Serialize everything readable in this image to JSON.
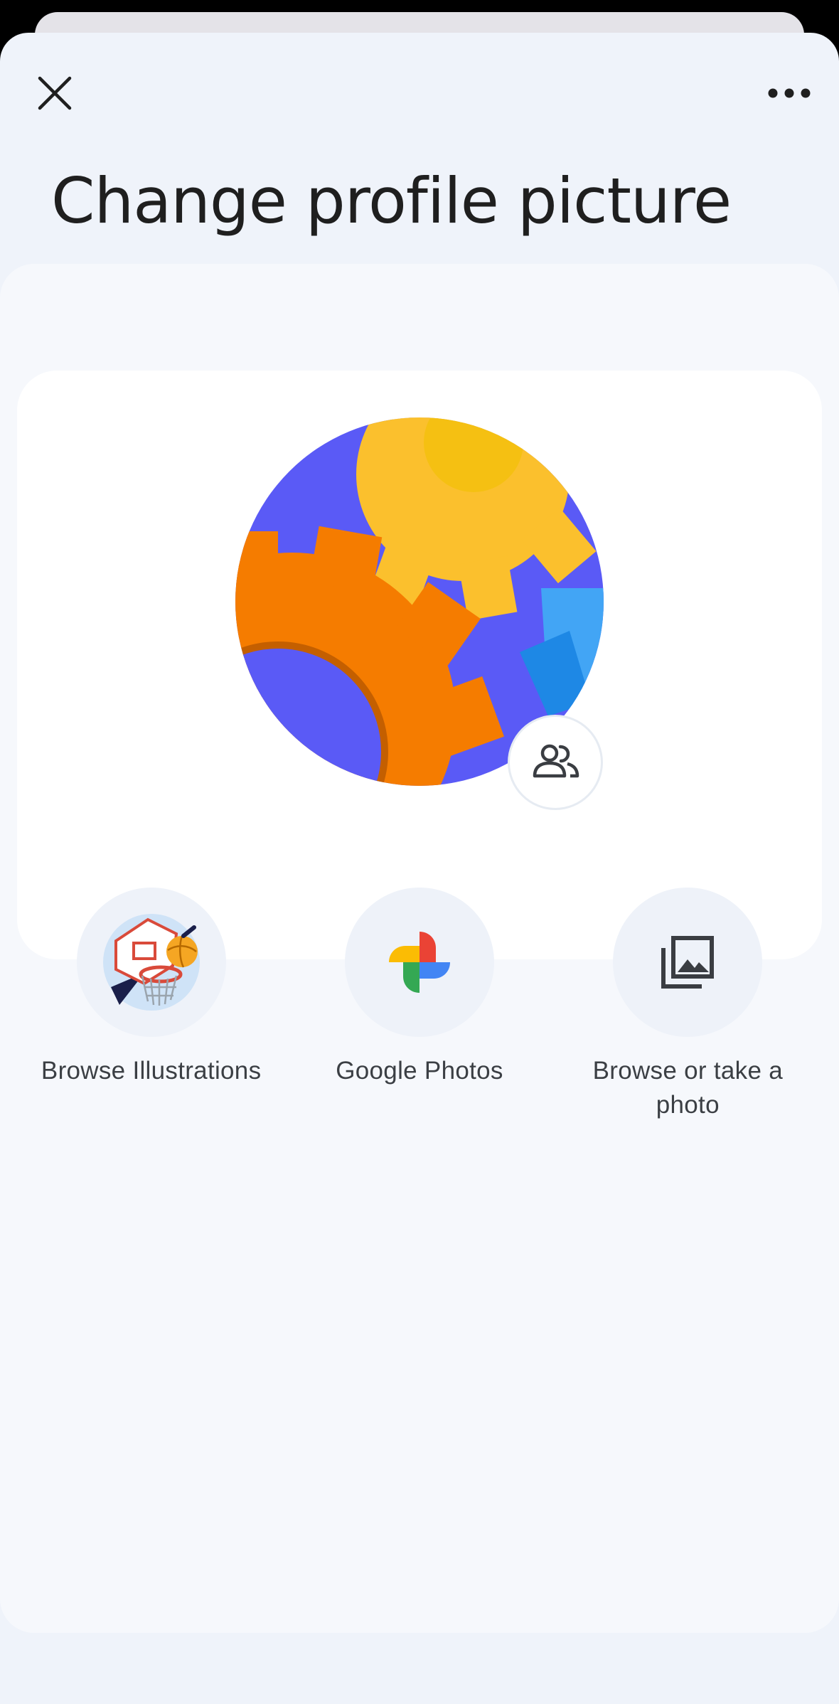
{
  "dialog": {
    "title": "Change profile picture"
  },
  "options": [
    {
      "label": "Browse Illustrations",
      "icon": "basketball-illustration-icon"
    },
    {
      "label": "Google Photos",
      "icon": "google-photos-pinwheel-icon"
    },
    {
      "label": "Browse or take a photo",
      "icon": "photo-library-icon"
    }
  ],
  "icons": {
    "close": "close-icon",
    "more": "more-horizontal-icon",
    "share": "people-icon",
    "avatar": "gears-illustration"
  },
  "colors": {
    "sheet_bg": "#eff3fa",
    "card_bg": "#ffffff",
    "title_text": "#1f1f1f",
    "label_text": "#3b3f44",
    "avatar_blue": "#5a5af6",
    "avatar_orange": "#f57c00",
    "avatar_yellow": "#fbc02d"
  }
}
